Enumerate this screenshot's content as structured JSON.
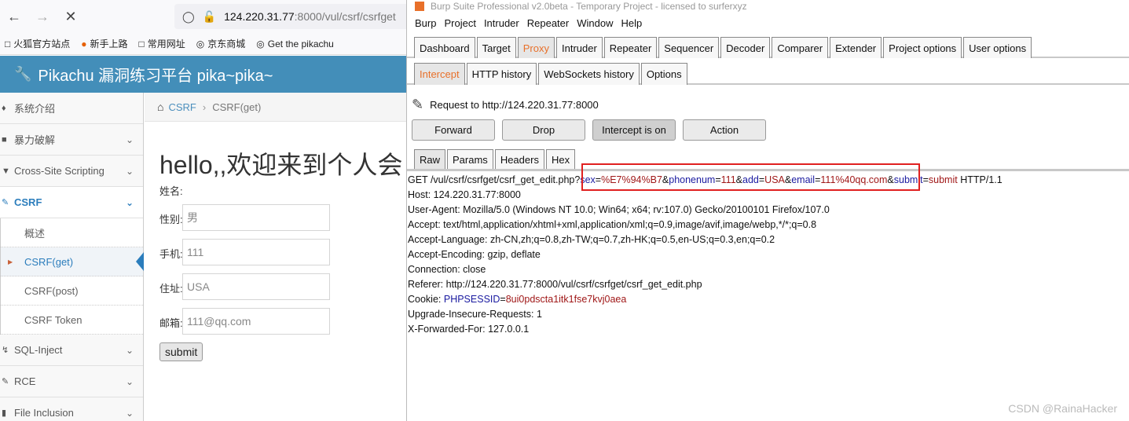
{
  "browser": {
    "url_main": "124.220.31.77",
    "url_rest": ":8000/vul/csrf/csrfget",
    "bookmarks": [
      "火狐官方站点",
      "新手上路",
      "常用网址",
      "京东商城",
      "Get the pikachu"
    ],
    "app_title": "Pikachu 漏洞练习平台 pika~pika~",
    "sidebar": {
      "items": [
        {
          "label": "系统介绍"
        },
        {
          "label": "暴力破解"
        },
        {
          "label": "Cross-Site Scripting"
        },
        {
          "label": "CSRF"
        },
        {
          "label": "SQL-Inject"
        },
        {
          "label": "RCE"
        },
        {
          "label": "File Inclusion"
        }
      ],
      "csrf_sub": [
        "概述",
        "CSRF(get)",
        "CSRF(post)",
        "CSRF Token"
      ]
    },
    "breadcrumb": {
      "link": "CSRF",
      "current": "CSRF(get)"
    },
    "greeting": "hello,,欢迎来到个人会",
    "form": {
      "name_label": "姓名:",
      "sex_label": "性别:",
      "sex_value": "男",
      "phone_label": "手机:",
      "phone_value": "111",
      "addr_label": "住址:",
      "addr_value": "USA",
      "email_label": "邮箱:",
      "email_value": "111@qq.com",
      "submit_label": "submit"
    }
  },
  "burp": {
    "title": "Burp Suite Professional v2.0beta - Temporary Project - licensed to surferxyz",
    "menu": [
      "Burp",
      "Project",
      "Intruder",
      "Repeater",
      "Window",
      "Help"
    ],
    "tabs": [
      "Dashboard",
      "Target",
      "Proxy",
      "Intruder",
      "Repeater",
      "Sequencer",
      "Decoder",
      "Comparer",
      "Extender",
      "Project options",
      "User options"
    ],
    "selected_tab": "Proxy",
    "proxy_tabs": [
      "Intercept",
      "HTTP history",
      "WebSockets history",
      "Options"
    ],
    "request_to": "Request to http://124.220.31.77:8000",
    "buttons": {
      "forward": "Forward",
      "drop": "Drop",
      "intercept": "Intercept is on",
      "action": "Action"
    },
    "editor_tabs": [
      "Raw",
      "Params",
      "Headers",
      "Hex"
    ],
    "raw": {
      "get_prefix": "GET /vul/csrf/csrfget/csrf_get_edit.php?",
      "params": [
        {
          "k": "sex",
          "v": "%E7%94%B7"
        },
        {
          "k": "phonenum",
          "v": "111"
        },
        {
          "k": "add",
          "v": "USA"
        },
        {
          "k": "email",
          "v": "111%40qq.com"
        },
        {
          "k": "submit",
          "v": "submit"
        }
      ],
      "get_suffix": " HTTP/1.1",
      "lines": [
        "Host: 124.220.31.77:8000",
        "User-Agent: Mozilla/5.0 (Windows NT 10.0; Win64; x64; rv:107.0) Gecko/20100101 Firefox/107.0",
        "Accept: text/html,application/xhtml+xml,application/xml;q=0.9,image/avif,image/webp,*/*;q=0.8",
        "Accept-Language: zh-CN,zh;q=0.8,zh-TW;q=0.7,zh-HK;q=0.5,en-US;q=0.3,en;q=0.2",
        "Accept-Encoding: gzip, deflate",
        "Connection: close",
        "Referer: http://124.220.31.77:8000/vul/csrf/csrfget/csrf_get_edit.php"
      ],
      "cookie_prefix": "Cookie: ",
      "cookie_k": "PHPSESSID",
      "cookie_v": "8ui0pdscta1itk1fse7kvj0aea",
      "lines_after": [
        "Upgrade-Insecure-Requests: 1",
        "X-Forwarded-For: 127.0.0.1"
      ]
    },
    "highlight_color": "#e02020"
  },
  "watermark": "CSDN @RainaHacker"
}
